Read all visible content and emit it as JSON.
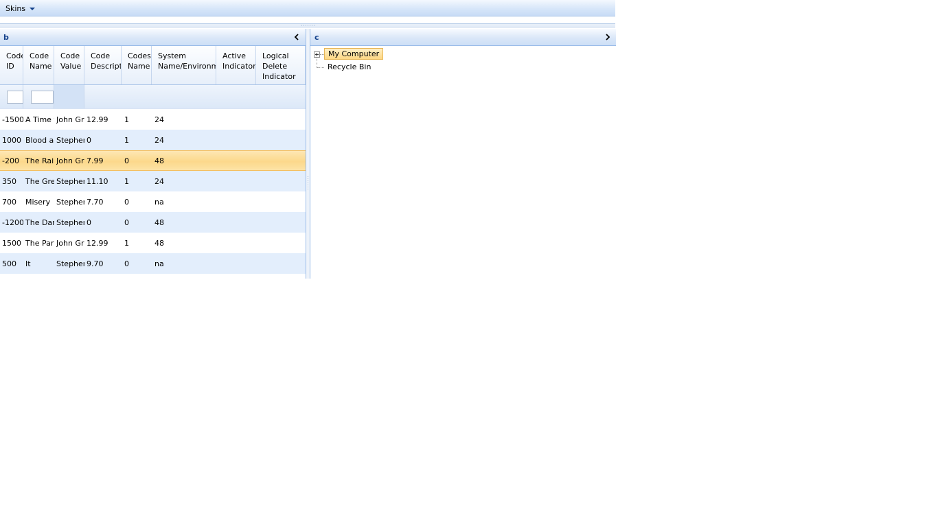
{
  "toolbar": {
    "skins_label": "Skins"
  },
  "panel_b": {
    "title": "b"
  },
  "panel_c": {
    "title": "c"
  },
  "grid": {
    "columns": [
      {
        "label": "Code\nID"
      },
      {
        "label": "Code\nName"
      },
      {
        "label": "Code\nValue"
      },
      {
        "label": "Code\nDescription"
      },
      {
        "label": "Codeset\nName"
      },
      {
        "label": "System\nName/Environment"
      },
      {
        "label": "Active\nIndicator"
      },
      {
        "label": "Logical\nDelete\nIndicator"
      }
    ],
    "rows": [
      {
        "id": "-1500",
        "name": "A Time to Kill",
        "value": "John Grisham",
        "desc": "12.99",
        "codeset": "1",
        "system": "24"
      },
      {
        "id": "1000",
        "name": "Blood and Smoke",
        "value": "Stephen King",
        "desc": "0",
        "codeset": "1",
        "system": "24"
      },
      {
        "id": "-200",
        "name": "The Rainmaker",
        "value": "John Grisham",
        "desc": "7.99",
        "codeset": "0",
        "system": "48"
      },
      {
        "id": "350",
        "name": "The Green Mile",
        "value": "Stephen King",
        "desc": "11.10",
        "codeset": "1",
        "system": "24"
      },
      {
        "id": "700",
        "name": "Misery",
        "value": "Stephen King",
        "desc": "7.70",
        "codeset": "0",
        "system": "na"
      },
      {
        "id": "-1200",
        "name": "The Dark Half",
        "value": "Stephen King",
        "desc": "0",
        "codeset": "0",
        "system": "48"
      },
      {
        "id": "1500",
        "name": "The Partner",
        "value": "John Grisham",
        "desc": "12.99",
        "codeset": "1",
        "system": "48"
      },
      {
        "id": "500",
        "name": "It",
        "value": "Stephen King",
        "desc": "9.70",
        "codeset": "0",
        "system": "na"
      }
    ]
  },
  "tree": {
    "nodes": [
      {
        "label": "My Computer"
      },
      {
        "label": "Recycle Bin"
      }
    ]
  }
}
